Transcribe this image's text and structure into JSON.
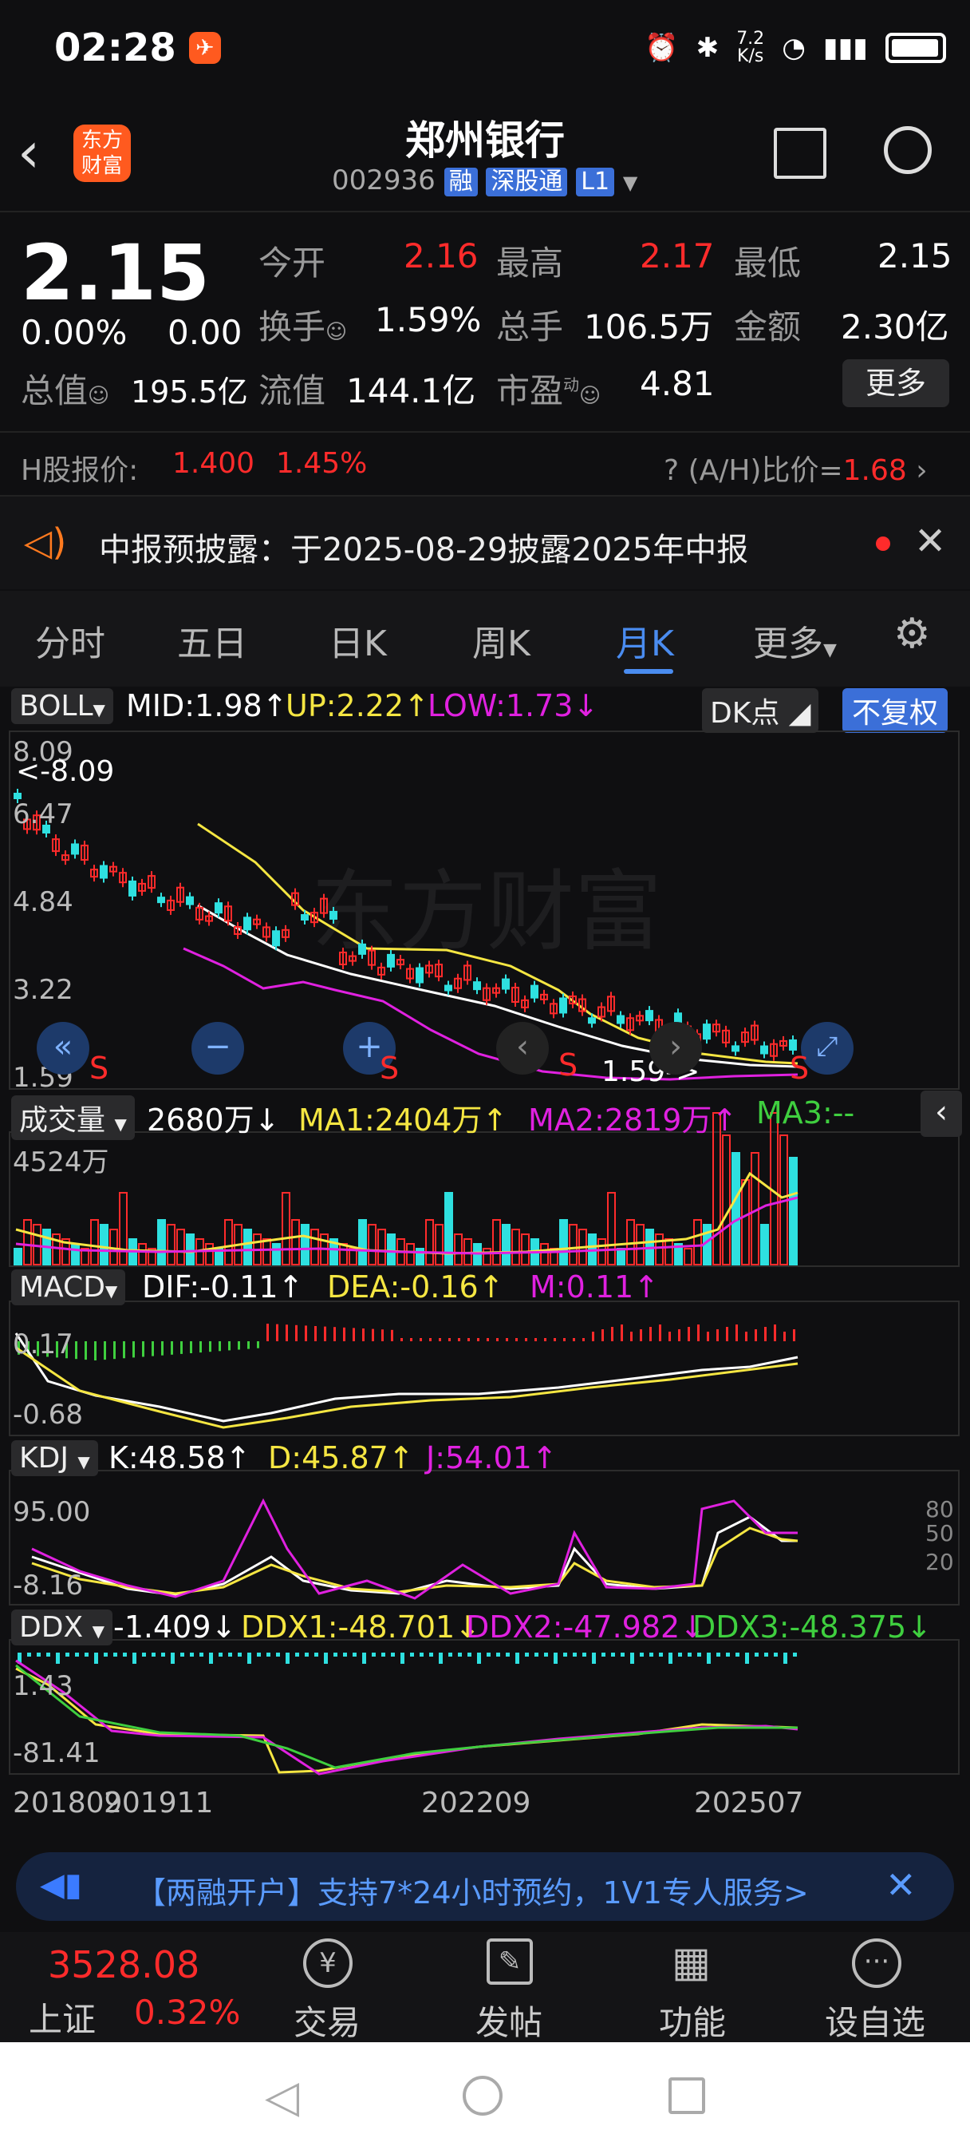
{
  "status_bar": {
    "time": "02:28",
    "net_speed_value": "7.2",
    "net_speed_unit": "K/s"
  },
  "header": {
    "logo_line1": "东方",
    "logo_line2": "财富",
    "title": "郑州银行",
    "code": "002936",
    "tag_rong": "融",
    "tag_sgt": "深股通",
    "tag_l1": "L1"
  },
  "quote": {
    "price": "2.15",
    "pct": "0.00%",
    "chg": "0.00",
    "open_label": "今开",
    "open": "2.16",
    "high_label": "最高",
    "high": "2.17",
    "low_label": "最低",
    "low": "2.15",
    "turnover_label": "换手",
    "turnover": "1.59%",
    "vol_label": "总手",
    "vol": "106.5万",
    "amount_label": "金额",
    "amount": "2.30亿",
    "mktcap_label": "总值",
    "mktcap": "195.5亿",
    "float_label": "流值",
    "float": "144.1亿",
    "pe_label": "市盈",
    "pe_sup": "动",
    "pe": "4.81",
    "more": "更多"
  },
  "hshare": {
    "label": "H股报价:",
    "price": "1.400",
    "pct": "1.45%",
    "ratio_label": "(A/H)比价=",
    "ratio": "1.68"
  },
  "notice": {
    "text": "中报预披露：于2025-08-29披露2025年中报"
  },
  "tabs": [
    "分时",
    "五日",
    "日K",
    "周K",
    "月K",
    "更多"
  ],
  "active_tab": "月K",
  "boll": {
    "name": "BOLL",
    "mid": "MID:1.98↑",
    "up": "UP:2.22↑",
    "low": "LOW:1.73↓",
    "dk": "DK点",
    "fq": "不复权",
    "y_top": "8.09",
    "y_2": "6.47",
    "y_3": "4.84",
    "y_4": "3.22",
    "y_5": "1.59",
    "max_note": "<-8.09",
    "min_note": "1.59->",
    "watermark": "东方财富"
  },
  "volume": {
    "name": "成交量",
    "value": "2680万↓",
    "ma1": "MA1:2404万↑",
    "ma2": "MA2:2819万↑",
    "ma3": "MA3:--",
    "y_top": "4524万"
  },
  "macd": {
    "name": "MACD",
    "dif": "DIF:-0.11↑",
    "dea": "DEA:-0.16↑",
    "m": "M:0.11↑",
    "y_top": "0.17",
    "y_bot": "-0.68"
  },
  "kdj": {
    "name": "KDJ",
    "k": "K:48.58↑",
    "d": "D:45.87↑",
    "j": "J:54.01↑",
    "y_top": "95.00",
    "y_bot": "-8.16",
    "r80": "80",
    "r50": "50",
    "r20": "20"
  },
  "ddx": {
    "name": "DDX",
    "val": "-1.409↓",
    "ddx1": "DDX1:-48.701↓",
    "ddx2": "DDX2:-47.982↓",
    "ddx3": "DDX3:-48.375↓",
    "y_top": "1.43",
    "y_bot": "-81.41"
  },
  "xaxis": {
    "d1": "201809",
    "d2": "201911",
    "d3": "202209",
    "d4": "202507"
  },
  "banner": {
    "text": "【两融开户】支持7*24小时预约，1V1专人服务>"
  },
  "bottom": {
    "index": "3528.08",
    "index_name": "上证",
    "index_pct": "0.32%",
    "trade": "交易",
    "post": "发帖",
    "func": "功能",
    "watch": "设自选"
  },
  "colors": {
    "red": "#ff2b2b",
    "yellow": "#f5e642",
    "magenta": "#e021e0",
    "green": "#3fcf3f",
    "cyan": "#2ee0e0",
    "blue": "#3b6fd8"
  }
}
